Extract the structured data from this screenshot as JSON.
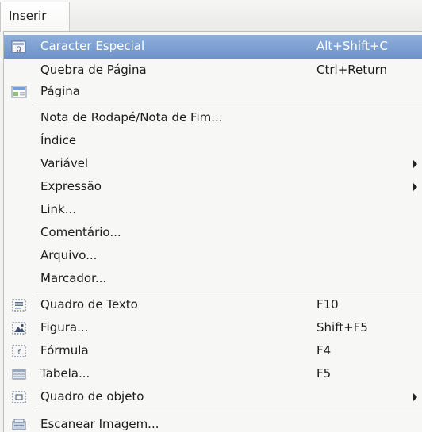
{
  "menubar": {
    "title": "Inserir"
  },
  "menu": {
    "items": [
      {
        "label": "Caracter Especial",
        "accel": "Alt+Shift+C",
        "icon": "special-character-icon"
      },
      {
        "label": "Quebra de Página",
        "accel": "Ctrl+Return"
      },
      {
        "label": "Página",
        "icon": "page-icon"
      },
      {
        "label": "Nota de Rodapé/Nota de Fim..."
      },
      {
        "label": "Índice",
        "submenu": true
      },
      {
        "label": "Variável",
        "submenu": true
      },
      {
        "label": "Expressão",
        "submenu": true
      },
      {
        "label": "Link..."
      },
      {
        "label": "Comentário..."
      },
      {
        "label": "Arquivo..."
      },
      {
        "label": "Marcador..."
      },
      {
        "label": "Quadro de Texto",
        "accel": "F10",
        "icon": "text-frame-icon"
      },
      {
        "label": "Figura...",
        "accel": "Shift+F5",
        "icon": "image-icon"
      },
      {
        "label": "Fórmula",
        "accel": "F4",
        "icon": "formula-icon"
      },
      {
        "label": "Tabela...",
        "accel": "F5",
        "icon": "table-icon"
      },
      {
        "label": "Quadro de objeto",
        "icon": "object-frame-icon",
        "submenu": true
      },
      {
        "label": "Escanear Imagem...",
        "icon": "scanner-icon"
      }
    ]
  },
  "colors": {
    "highlight": "#7d9fd3",
    "menu_background": "#f7f7f6"
  }
}
